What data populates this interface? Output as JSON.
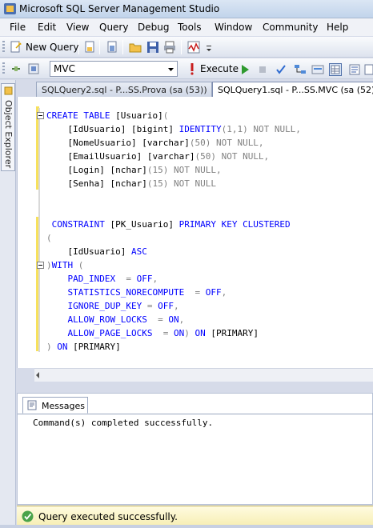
{
  "window": {
    "title": "Microsoft SQL Server Management Studio"
  },
  "menu": [
    "File",
    "Edit",
    "View",
    "Query",
    "Debug",
    "Tools",
    "Window",
    "Community",
    "Help"
  ],
  "toolbar": {
    "new_query_label": "New Query",
    "database_selected": "MVC",
    "execute_label": "Execute"
  },
  "side_panel": {
    "label": "Object Explorer"
  },
  "tabs": [
    {
      "label": "SQLQuery2.sql - P...SS.Prova (sa (53))"
    },
    {
      "label": "SQLQuery1.sql - P...SS.MVC (sa (52))*"
    }
  ],
  "results": {
    "tab_label": "Messages",
    "message": "Command(s) completed successfully."
  },
  "status": {
    "text": "Query executed successfully."
  },
  "colors": {
    "keyword": "#0000ff",
    "operator": "#808080",
    "identifier": "#000000",
    "status_bg": "#fdf6c8"
  },
  "code_lines": [
    "CREATE TABLE [Usuario](",
    "    [IdUsuario] [bigint] IDENTITY(1,1) NOT NULL,",
    "    [NomeUsuario] [varchar](50) NOT NULL,",
    "    [EmailUsuario] [varchar](50) NOT NULL,",
    "    [Login] [nchar](15) NOT NULL,",
    "    [Senha] [nchar](15) NOT NULL",
    "",
    "",
    " CONSTRAINT [PK_Usuario] PRIMARY KEY CLUSTERED",
    "(",
    "    [IdUsuario] ASC",
    ")WITH (",
    "    PAD_INDEX  = OFF,",
    "    STATISTICS_NORECOMPUTE  = OFF,",
    "    IGNORE_DUP_KEY = OFF,",
    "    ALLOW_ROW_LOCKS  = ON,",
    "    ALLOW_PAGE_LOCKS  = ON) ON [PRIMARY]",
    ") ON [PRIMARY]"
  ]
}
